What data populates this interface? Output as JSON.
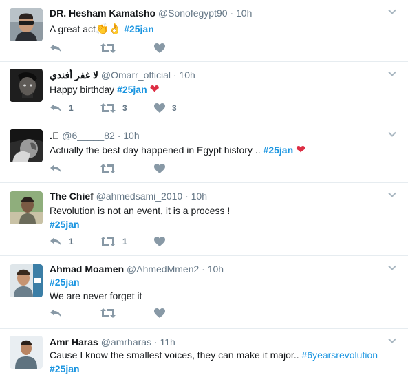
{
  "colors": {
    "link": "#1b95e0",
    "secondary": "#657786",
    "divider": "#e6ecf0",
    "heart": "#dd2e44"
  },
  "tweets": [
    {
      "name": "DR. Hesham Kamatsho",
      "handle": "@Sonofegypt90",
      "separator": "·",
      "time": "10h",
      "text": "A great act",
      "emoji": "👏👌",
      "hashtag": "#25jan",
      "reply_count": "",
      "retweet_count": "",
      "like_count": ""
    },
    {
      "name": "لا غفر أفندي",
      "handle": "@Omarr_official",
      "separator": "·",
      "time": "10h",
      "text": "Happy birthday",
      "hashtag": "#25jan",
      "heart": "❤",
      "reply_count": "1",
      "retweet_count": "3",
      "like_count": "3"
    },
    {
      "name": ".ﾟ",
      "handle": "@6_____82",
      "separator": "·",
      "time": "10h",
      "text": "Actually the best day happened in Egypt history ..",
      "hashtag": "#25jan",
      "heart": "❤",
      "reply_count": "",
      "retweet_count": "",
      "like_count": ""
    },
    {
      "name": "The Chief",
      "handle": "@ahmedsami_2010",
      "separator": "·",
      "time": "10h",
      "text": "Revolution is not an event, it is a process !",
      "hashtag": "#25jan",
      "reply_count": "1",
      "retweet_count": "1",
      "like_count": ""
    },
    {
      "name": "Ahmad Moamen",
      "handle": "@AhmedMmen2",
      "separator": "·",
      "time": "10h",
      "hashtag": "#25jan",
      "text": "We are never forget it",
      "reply_count": "",
      "retweet_count": "",
      "like_count": ""
    },
    {
      "name": "Amr Haras",
      "handle": "@amrharas",
      "separator": "·",
      "time": "11h",
      "text": "Cause I know the smallest voices, they can make it major..",
      "hashtag_inline": "#6yearsrevolution",
      "hashtag": "#25jan"
    }
  ],
  "icons": {
    "reply": "reply-icon",
    "retweet": "retweet-icon",
    "like": "heart-icon",
    "more": "chevron-down-icon"
  }
}
